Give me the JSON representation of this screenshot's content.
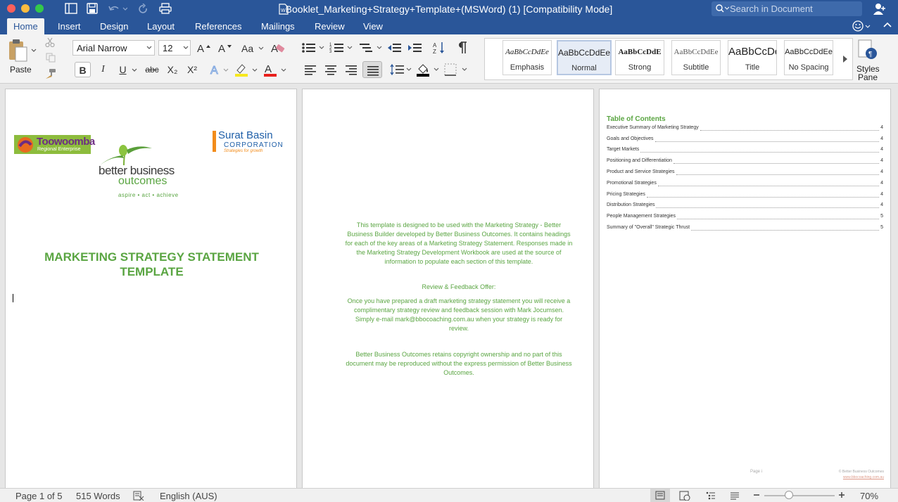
{
  "window": {
    "title": "Booklet_Marketing+Strategy+Template+(MSWord) (1) [Compatibility Mode]",
    "search_placeholder": "Search in Document"
  },
  "tabs": [
    "Home",
    "Insert",
    "Design",
    "Layout",
    "References",
    "Mailings",
    "Review",
    "View"
  ],
  "ribbon": {
    "paste_label": "Paste",
    "font_name": "Arial Narrow",
    "font_size": "12",
    "bold": "B",
    "italic": "I",
    "underline": "U",
    "strike": "abc",
    "subscript": "X₂",
    "superscript": "X²",
    "styles": [
      {
        "preview": "AaBbCcDdEe",
        "name": "Emphasis"
      },
      {
        "preview": "AaBbCcDdEe",
        "name": "Normal"
      },
      {
        "preview": "AaBbCcDdE",
        "name": "Strong"
      },
      {
        "preview": "AaBbCcDdEe",
        "name": "Subtitle"
      },
      {
        "preview": "AaBbCcDc",
        "name": "Title"
      },
      {
        "preview": "AaBbCcDdEe",
        "name": "No Spacing"
      }
    ],
    "styles_pane_label_1": "Styles",
    "styles_pane_label_2": "Pane",
    "highlight_color": "#f7e81e",
    "font_color": "#e8201c",
    "shading_color": "#000000"
  },
  "page1": {
    "logo_left_1": "Toowoomba",
    "logo_left_2": "Regional Enterprise",
    "logo_right_1": "Surat Basin",
    "logo_right_2": "CORPORATION",
    "logo_right_3": "Strategies for growth",
    "logo_center_1": "better business",
    "logo_center_2": "outcomes",
    "logo_center_3": "aspire • act • achieve",
    "title_1": "MARKETING STRATEGY STATEMENT",
    "title_2": "TEMPLATE"
  },
  "page2": {
    "para1": "This template is designed to be used with the Marketing Strategy - Better Business Builder developed by Better Business Outcomes. It contains headings for each of the key areas of a Marketing Strategy Statement. Responses made in the Marketing Strategy Development Workbook are used at the source of information to populate each section of this template.",
    "heading": "Review & Feedback Offer:",
    "para2": "Once you have prepared a draft marketing strategy statement you will receive a complimentary strategy review and feedback session with Mark Jocumsen. Simply e-mail mark@bbocoaching.com.au when your strategy is ready for review.",
    "para3": "Better Business Outcomes retains copyright ownership and no part of this document may be reproduced without the express permission of Better Business Outcomes."
  },
  "page3": {
    "toc_title": "Table of Contents",
    "toc": [
      {
        "title": "Executive Summary of Marketing Strategy",
        "page": "4"
      },
      {
        "title": "Goals and Objectives",
        "page": "4"
      },
      {
        "title": "Target Markets",
        "page": "4"
      },
      {
        "title": "Positioning and Differentiation",
        "page": "4"
      },
      {
        "title": "Product and Service Strategies",
        "page": "4"
      },
      {
        "title": "Promotional Strategies",
        "page": "4"
      },
      {
        "title": "Pricing Strategies",
        "page": "4"
      },
      {
        "title": "Distribution Strategies",
        "page": "4"
      },
      {
        "title": "People Management Strategies",
        "page": "5"
      },
      {
        "title": "Summary of \"Overall\" Strategic Thrust",
        "page": "5"
      }
    ],
    "footer_left": "Page i",
    "footer_right_1": "© Better Business Outcomes",
    "footer_right_2": "www.bbocoaching.com.au"
  },
  "status": {
    "page": "Page 1 of 5",
    "words": "515 Words",
    "language": "English (AUS)",
    "zoom": "70%"
  }
}
